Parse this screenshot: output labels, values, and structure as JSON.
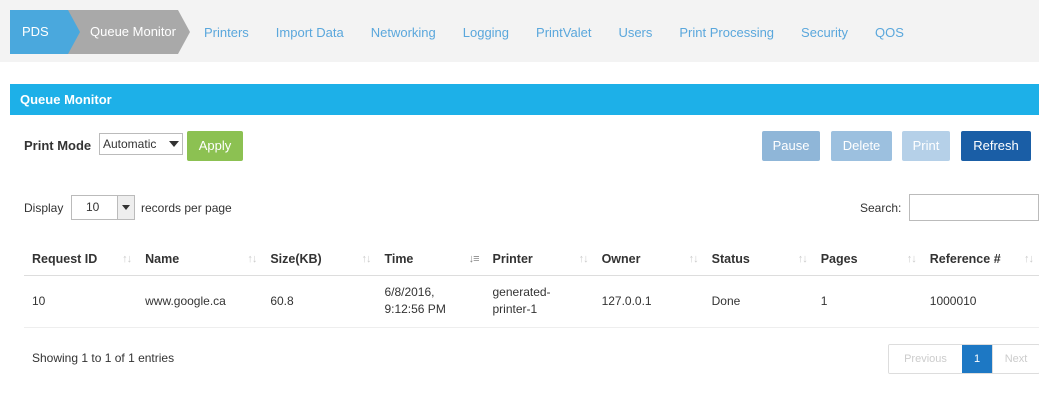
{
  "breadcrumb": {
    "root": "PDS",
    "current": "Queue Monitor"
  },
  "nav": [
    "Printers",
    "Import Data",
    "Networking",
    "Logging",
    "PrintValet",
    "Users",
    "Print Processing",
    "Security",
    "QOS"
  ],
  "panel": {
    "title": "Queue Monitor"
  },
  "controls": {
    "print_mode_label": "Print Mode",
    "print_mode_value": "Automatic",
    "apply": "Apply",
    "pause": "Pause",
    "delete": "Delete",
    "print": "Print",
    "refresh": "Refresh"
  },
  "display": {
    "prefix": "Display",
    "value": "10",
    "suffix": "records per page"
  },
  "search": {
    "label": "Search:",
    "value": ""
  },
  "table": {
    "columns": [
      "Request ID",
      "Name",
      "Size(KB)",
      "Time",
      "Printer",
      "Owner",
      "Status",
      "Pages",
      "Reference #"
    ],
    "rows": [
      {
        "request_id": "10",
        "name": "www.google.ca",
        "size": "60.8",
        "time_line1": "6/8/2016,",
        "time_line2": "9:12:56 PM",
        "printer_line1": "generated-",
        "printer_line2": "printer-1",
        "owner": "127.0.0.1",
        "status": "Done",
        "pages": "1",
        "reference": "1000010"
      }
    ]
  },
  "footer": {
    "info": "Showing 1 to 1 of 1 entries",
    "previous": "Previous",
    "page": "1",
    "next": "Next"
  },
  "colors": {
    "accent": "#1db0e8",
    "breadcrumb_root": "#4aa8dd",
    "breadcrumb_current": "#a9a9a9",
    "apply": "#8cc152",
    "refresh": "#1a5ea6"
  }
}
